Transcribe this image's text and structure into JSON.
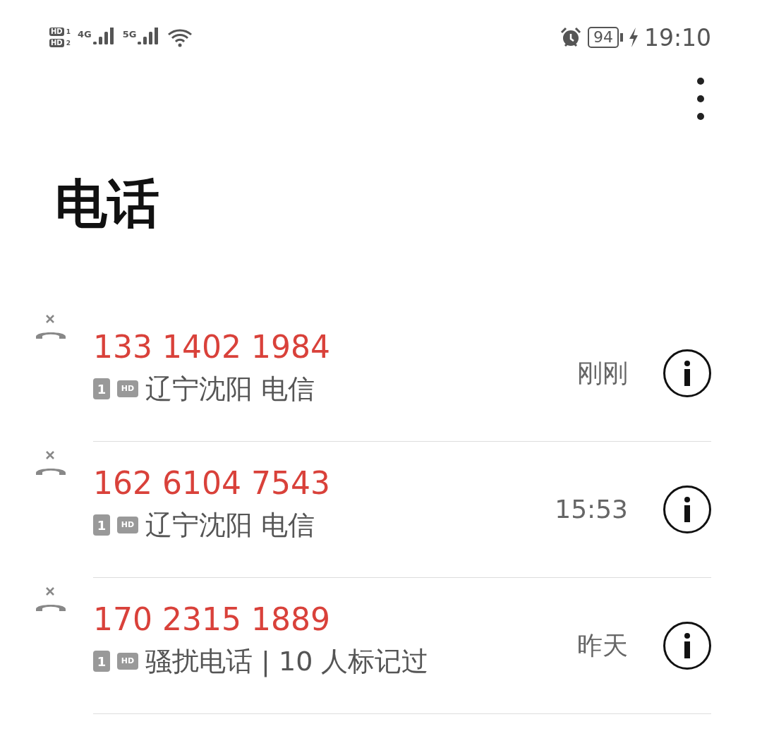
{
  "status_bar": {
    "sims": [
      {
        "hd": "HD",
        "slot": "1"
      },
      {
        "hd": "HD",
        "slot": "2"
      }
    ],
    "networks": [
      "4G",
      "5G"
    ],
    "battery": "94",
    "time": "19:10"
  },
  "title": "电话",
  "calls": [
    {
      "number": "133 1402 1984",
      "missed": true,
      "sim": "1",
      "hd": "HD",
      "location": "辽宁沈阳 电信",
      "time": "刚刚"
    },
    {
      "number": "162 6104 7543",
      "missed": true,
      "sim": "1",
      "hd": "HD",
      "location": "辽宁沈阳 电信",
      "time": "15:53"
    },
    {
      "number": "170 2315 1889",
      "missed": true,
      "sim": "1",
      "hd": "HD",
      "location": "骚扰电话 | 10 人标记过",
      "time": "昨天"
    }
  ]
}
